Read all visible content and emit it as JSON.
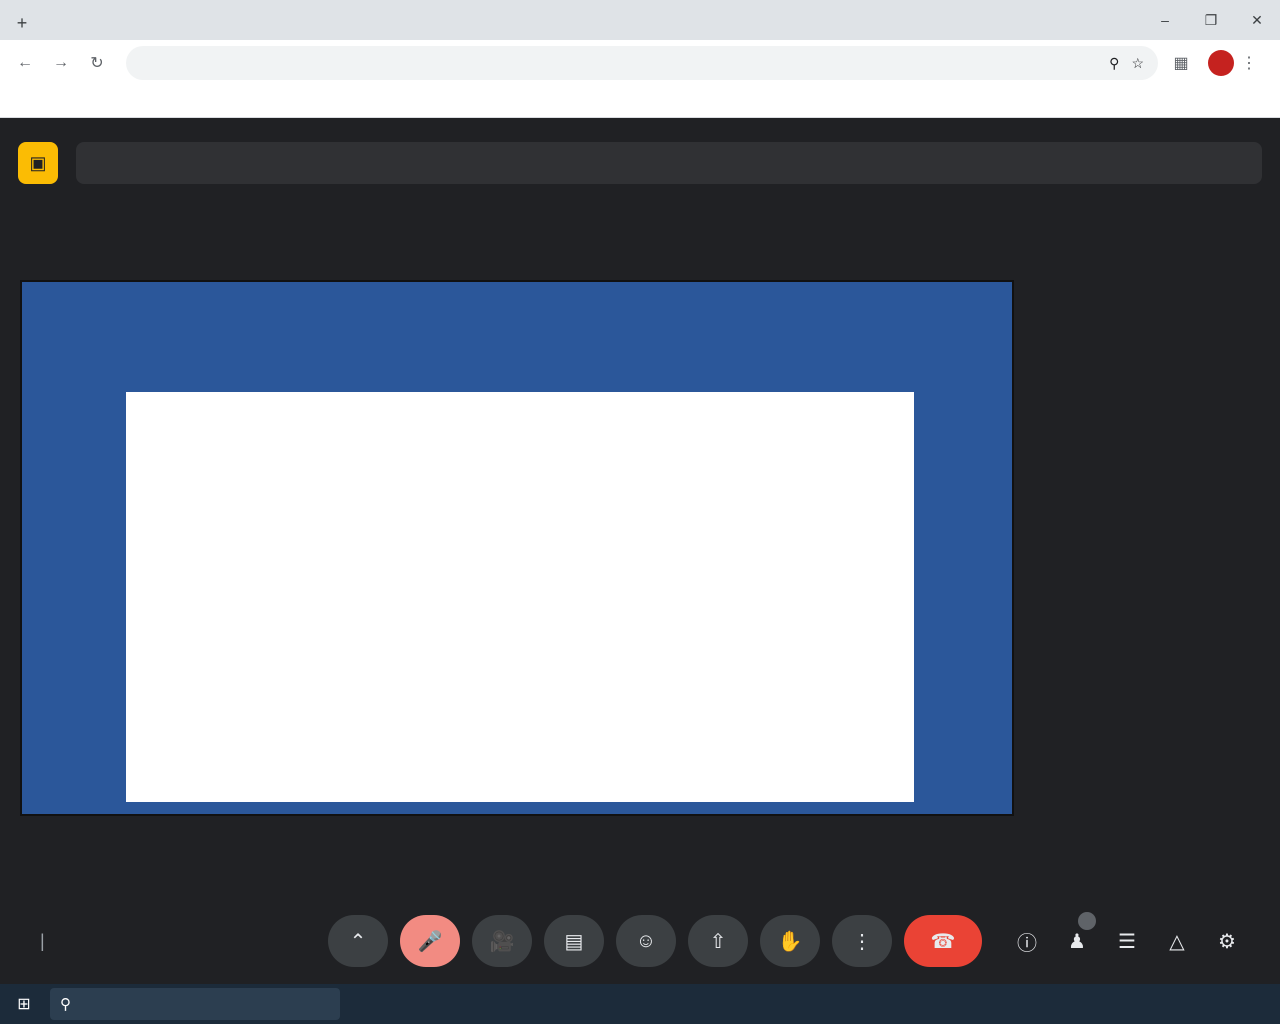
{
  "browser": {
    "tabs": [],
    "omnibox": {
      "url": ""
    },
    "bookmarks": [],
    "bookmarks_all_label": "",
    "profile_initial": ""
  },
  "meeting": {
    "presenter_label": "",
    "document": {
      "heading": "",
      "paragraphs": []
    },
    "participants": [],
    "clock": "",
    "code": ""
  },
  "controls": {
    "people_count": ""
  },
  "taskbar": {
    "search_placeholder": "",
    "apps": [],
    "weather": "",
    "lang": "",
    "time": "",
    "date": ""
  }
}
